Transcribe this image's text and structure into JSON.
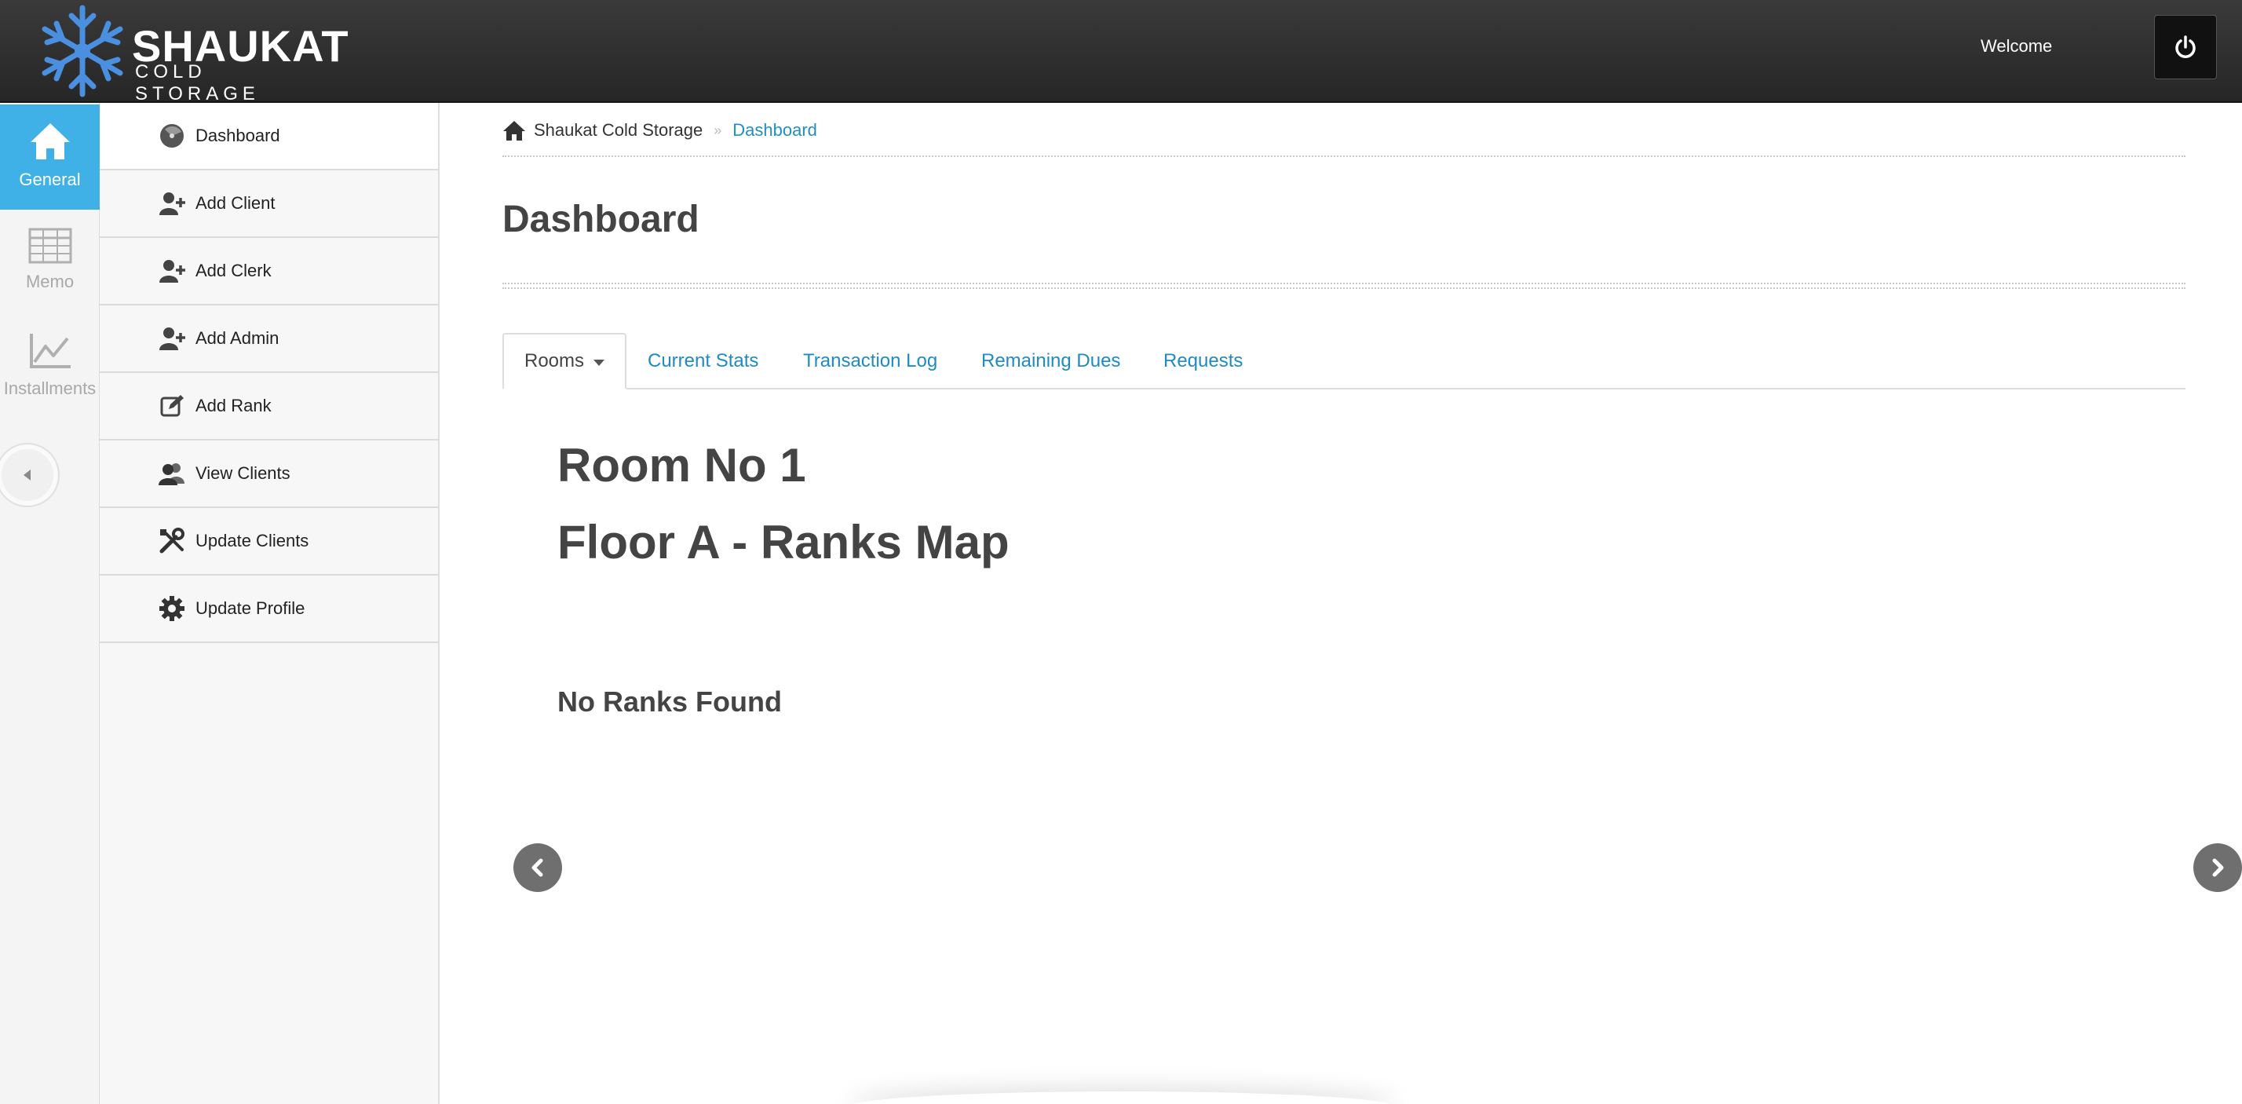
{
  "header": {
    "brand_title": "SHAUKAT",
    "brand_subtitle": "COLD STORAGE",
    "welcome": "Welcome"
  },
  "rail": {
    "items": [
      {
        "label": "General",
        "icon": "home-icon",
        "active": true
      },
      {
        "label": "Memo",
        "icon": "table-icon",
        "active": false
      },
      {
        "label": "Installments",
        "icon": "line-chart-icon",
        "active": false
      }
    ]
  },
  "submenu": {
    "items": [
      {
        "label": "Dashboard",
        "icon": "dashboard-icon"
      },
      {
        "label": "Add Client",
        "icon": "add-user-icon"
      },
      {
        "label": "Add Clerk",
        "icon": "add-user-icon"
      },
      {
        "label": "Add Admin",
        "icon": "add-user-icon"
      },
      {
        "label": "Add Rank",
        "icon": "edit-icon"
      },
      {
        "label": "View Clients",
        "icon": "users-icon"
      },
      {
        "label": "Update Clients",
        "icon": "tools-icon"
      },
      {
        "label": "Update Profile",
        "icon": "gear-icon"
      }
    ]
  },
  "breadcrumb": {
    "root": "Shaukat Cold Storage",
    "separator": "»",
    "current": "Dashboard"
  },
  "page": {
    "title": "Dashboard"
  },
  "tabs": [
    {
      "label": "Rooms",
      "active": true,
      "dropdown": true
    },
    {
      "label": "Current Stats"
    },
    {
      "label": "Transaction Log"
    },
    {
      "label": "Remaining Dues"
    },
    {
      "label": "Requests"
    }
  ],
  "content": {
    "room_title": "Room No 1",
    "floor_title": "Floor A - Ranks Map",
    "empty_message": "No Ranks Found"
  },
  "colors": {
    "accent": "#3fb1e6",
    "link": "#1e8bc3",
    "topbar": "#2e2e2e"
  }
}
